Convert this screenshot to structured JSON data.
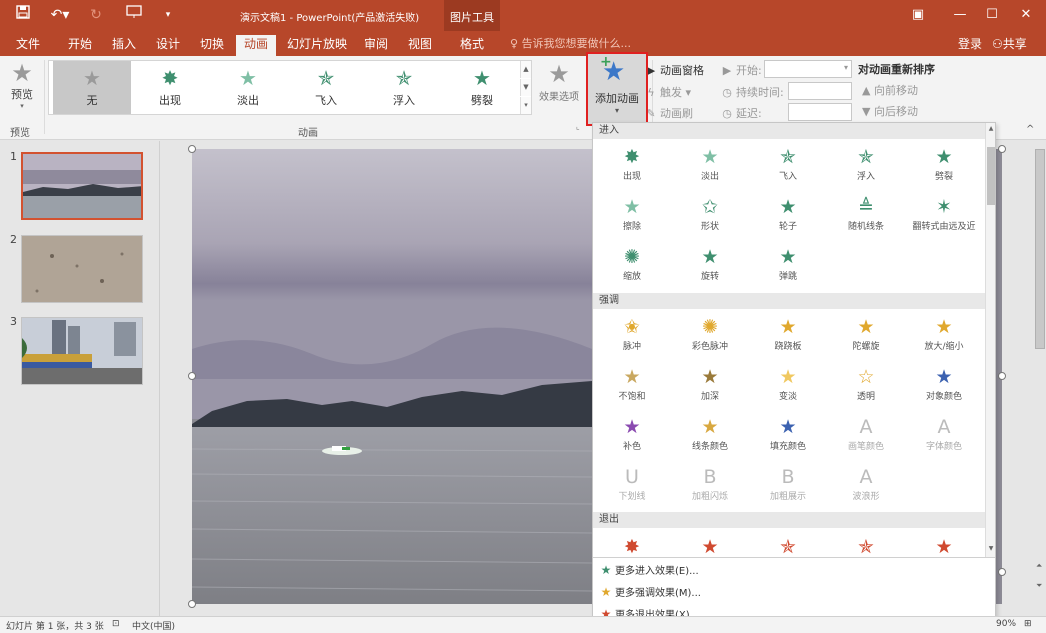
{
  "titlebar": {
    "title": "演示文稿1 - PowerPoint(产品激活失败)",
    "context_tab": "图片工具",
    "qat": {
      "save_icon": "save-icon",
      "undo_icon": "undo-icon",
      "redo_icon": "redo-icon",
      "present_icon": "present-from-start-icon",
      "customize_icon": "customize-qat-icon"
    },
    "window_buttons": {
      "ribbon_display": "▣",
      "minimize": "—",
      "restore": "☐",
      "close": "✕"
    }
  },
  "tabs": [
    "文件",
    "开始",
    "插入",
    "设计",
    "切换",
    "动画",
    "幻灯片放映",
    "审阅",
    "视图",
    "格式"
  ],
  "active_tab": "动画",
  "tellme": "告诉我您想要做什么...",
  "login": "登录",
  "share": "共享",
  "ribbon": {
    "preview_label": "预览",
    "preview_group": "预览",
    "animation_group": "动画",
    "gallery": [
      {
        "label": "无",
        "icon": "★",
        "color": "#9a9a9a",
        "selected": true
      },
      {
        "label": "出现",
        "icon": "✸",
        "color": "#3f8f6f"
      },
      {
        "label": "淡出",
        "icon": "★",
        "color": "#7fbfa5"
      },
      {
        "label": "飞入",
        "icon": "✯",
        "color": "#3f8f6f"
      },
      {
        "label": "浮入",
        "icon": "✯",
        "color": "#3f8f6f"
      },
      {
        "label": "劈裂",
        "icon": "★",
        "color": "#3f8f6f"
      }
    ],
    "effect_options": "效果选项",
    "add_animation": "添加动画",
    "anim_pane": "动画窗格",
    "trigger": "触发",
    "anim_painter": "动画刷",
    "start_label": "开始:",
    "duration_label": "持续时间:",
    "delay_label": "延迟:",
    "reorder_title": "对动画重新排序",
    "move_earlier": "向前移动",
    "move_later": "向后移动"
  },
  "slides": [
    {
      "num": "1",
      "scene": "lake-mountains"
    },
    {
      "num": "2",
      "scene": "sand"
    },
    {
      "num": "3",
      "scene": "street"
    }
  ],
  "dropdown": {
    "sections": [
      {
        "title": "进入",
        "items": [
          {
            "label": "出现",
            "icon": "✸",
            "color": "#3f8f6f"
          },
          {
            "label": "淡出",
            "icon": "★",
            "color": "#7fbfa5"
          },
          {
            "label": "飞入",
            "icon": "✯",
            "color": "#3f8f6f"
          },
          {
            "label": "浮入",
            "icon": "✯",
            "color": "#3f8f6f"
          },
          {
            "label": "劈裂",
            "icon": "★",
            "color": "#3f8f6f"
          },
          {
            "label": "擦除",
            "icon": "★",
            "color": "#7fbfa5"
          },
          {
            "label": "形状",
            "icon": "✩",
            "color": "#3f8f6f"
          },
          {
            "label": "轮子",
            "icon": "★",
            "color": "#3f8f6f"
          },
          {
            "label": "随机线条",
            "icon": "≜",
            "color": "#3f8f6f"
          },
          {
            "label": "翻转式由远及近",
            "icon": "✶",
            "color": "#3f8f6f"
          },
          {
            "label": "缩放",
            "icon": "✺",
            "color": "#3f8f6f"
          },
          {
            "label": "旋转",
            "icon": "★",
            "color": "#3f8f6f"
          },
          {
            "label": "弹跳",
            "icon": "★",
            "color": "#3f8f6f"
          }
        ]
      },
      {
        "title": "强调",
        "items": [
          {
            "label": "脉冲",
            "icon": "✬",
            "color": "#e0a82e"
          },
          {
            "label": "彩色脉冲",
            "icon": "✺",
            "color": "#e0a82e"
          },
          {
            "label": "跷跷板",
            "icon": "★",
            "color": "#e0a82e"
          },
          {
            "label": "陀螺旋",
            "icon": "★",
            "color": "#e0a82e"
          },
          {
            "label": "放大/缩小",
            "icon": "★",
            "color": "#e0a82e"
          },
          {
            "label": "不饱和",
            "icon": "★",
            "color": "#c9a860"
          },
          {
            "label": "加深",
            "icon": "★",
            "color": "#9a7a3a"
          },
          {
            "label": "变淡",
            "icon": "★",
            "color": "#f0c860"
          },
          {
            "label": "透明",
            "icon": "☆",
            "color": "#e0a82e"
          },
          {
            "label": "对象颜色",
            "icon": "★",
            "color": "#3c62b0"
          },
          {
            "label": "补色",
            "icon": "★",
            "color": "#8a4ab0"
          },
          {
            "label": "线条颜色",
            "icon": "★",
            "color": "#d8a840"
          },
          {
            "label": "填充颜色",
            "icon": "★",
            "color": "#3c62b0"
          },
          {
            "label": "画笔颜色",
            "icon": "A",
            "color": "#bbbbbb",
            "disabled": true
          },
          {
            "label": "字体颜色",
            "icon": "A",
            "color": "#bbbbbb",
            "disabled": true
          },
          {
            "label": "下划线",
            "icon": "U",
            "color": "#bbbbbb",
            "disabled": true
          },
          {
            "label": "加粗闪烁",
            "icon": "B",
            "color": "#bbbbbb",
            "disabled": true
          },
          {
            "label": "加粗展示",
            "icon": "B",
            "color": "#bbbbbb",
            "disabled": true
          },
          {
            "label": "波浪形",
            "icon": "A",
            "color": "#bbbbbb",
            "disabled": true
          }
        ]
      },
      {
        "title": "退出",
        "items": [
          {
            "label": "",
            "icon": "✸",
            "color": "#d04a30"
          },
          {
            "label": "",
            "icon": "★",
            "color": "#d04a30"
          },
          {
            "label": "",
            "icon": "✯",
            "color": "#d04a30"
          },
          {
            "label": "",
            "icon": "✯",
            "color": "#d04a30"
          },
          {
            "label": "",
            "icon": "★",
            "color": "#d04a30"
          }
        ]
      }
    ],
    "more": [
      {
        "label": "更多进入效果(E)...",
        "icon": "★",
        "color": "#3f8f6f"
      },
      {
        "label": "更多强调效果(M)...",
        "icon": "★",
        "color": "#e0a82e"
      },
      {
        "label": "更多退出效果(X)...",
        "icon": "★",
        "color": "#d04a30"
      }
    ]
  },
  "status": {
    "slide": "幻灯片 第 1 张，共 3 张",
    "language": "中文(中国)",
    "zoom": "90%"
  }
}
